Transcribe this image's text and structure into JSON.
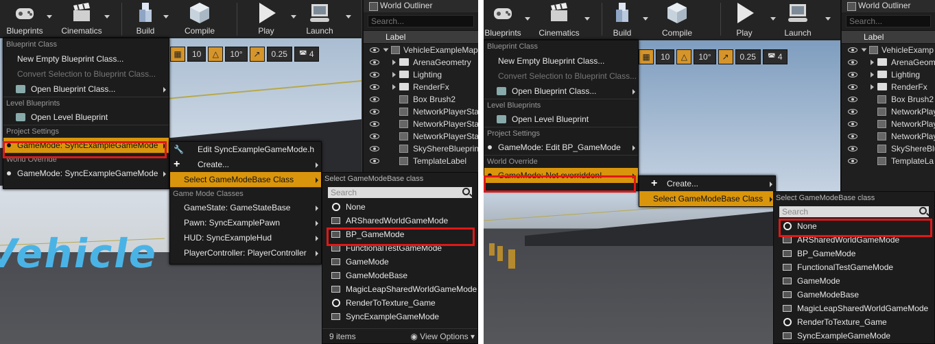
{
  "toolbar": {
    "blueprints": "Blueprints",
    "cinematics": "Cinematics",
    "build": "Build",
    "compile": "Compile",
    "play": "Play",
    "launch": "Launch"
  },
  "viewport_tools": {
    "grid": "10",
    "rotate": "10°",
    "scale": "0.25",
    "camera_speed": "4"
  },
  "outliner": {
    "title": "World Outliner",
    "search_placeholder": "Search...",
    "column": "Label",
    "left_items": [
      "VehicleExampleMap",
      "ArenaGeometry",
      "Lighting",
      "RenderFx",
      "Box Brush2",
      "NetworkPlayerSta",
      "NetworkPlayerSta",
      "NetworkPlayerSta",
      "SkyShereBlueprin",
      "TemplateLabel"
    ],
    "right_items": [
      "VehicleExamp",
      "ArenaGeom",
      "Lighting",
      "RenderFx",
      "Box Brush2",
      "NetworkPlay",
      "NetworkPlay",
      "NetworkPlay",
      "SkyShereBlu",
      "TemplateLa"
    ]
  },
  "blueprint_menu": {
    "header_class": "Blueprint Class",
    "new_empty": "New Empty Blueprint Class...",
    "convert": "Convert Selection to Blueprint Class...",
    "open_class": "Open Blueprint Class...",
    "header_level": "Level Blueprints",
    "open_level": "Open Level Blueprint",
    "header_project": "Project Settings",
    "left_project_gm": "GameMode: SyncExampleGameMode",
    "right_project_gm": "GameMode: Edit BP_GameMode",
    "header_world": "World Override",
    "left_world_gm": "GameMode: SyncExampleGameMode",
    "right_world_gm": "GameMode: Not overridden!"
  },
  "gamemode_submenu": {
    "edit": "Edit SyncExampleGameMode.h",
    "create": "Create...",
    "select": "Select GameModeBase Class",
    "header_classes": "Game Mode Classes",
    "gamestate": "GameState: GameStateBase",
    "pawn": "Pawn: SyncExamplePawn",
    "hud": "HUD: SyncExampleHud",
    "controller": "PlayerController: PlayerController"
  },
  "picker": {
    "title": "Select GameModeBase class",
    "title_right": "Select GameModeBase Class",
    "search_placeholder": "Search",
    "items": [
      "None",
      "ARSharedWorldGameMode",
      "BP_GameMode",
      "FunctionalTestGameMode",
      "GameMode",
      "GameModeBase",
      "MagicLeapSharedWorldGameMode",
      "RenderToTexture_Game",
      "SyncExampleGameMode"
    ],
    "item_icons": [
      "circle",
      "class",
      "class",
      "class",
      "class",
      "class",
      "class",
      "circle",
      "class"
    ],
    "count": "9 items",
    "view_options": "View Options"
  },
  "colors": {
    "accent": "#d9950c",
    "highlight_box": "#e01818",
    "menu_bg": "#1c1c1c",
    "ground_text": "#4ab3e6"
  }
}
